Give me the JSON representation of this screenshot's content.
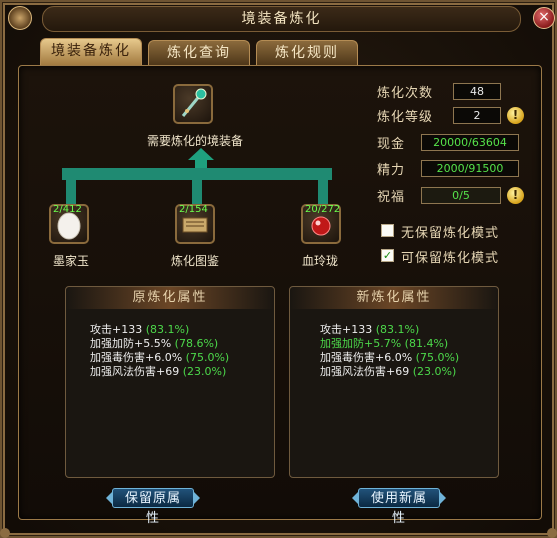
{
  "window": {
    "title": "境装备炼化",
    "close_label": "×"
  },
  "tabs": [
    {
      "label": "境装备炼化",
      "active": true
    },
    {
      "label": "炼化查询",
      "active": false
    },
    {
      "label": "炼化规则",
      "active": false
    }
  ],
  "target": {
    "label": "需要炼化的境装备",
    "icon": "staff-icon"
  },
  "materials": [
    {
      "count": "2/412",
      "name": "墨家玉",
      "icon": "jade-icon"
    },
    {
      "count": "2/154",
      "name": "炼化图鉴",
      "icon": "scroll-icon"
    },
    {
      "count": "20/272",
      "name": "血玲珑",
      "icon": "red-orb-icon"
    }
  ],
  "stats": {
    "refine_count_label": "炼化次数",
    "refine_count": "48",
    "refine_level_label": "炼化等级",
    "refine_level": "2",
    "cash_label": "现金",
    "cash": "20000/63604",
    "energy_label": "精力",
    "energy": "2000/91500",
    "blessing_label": "祝福",
    "blessing": "0/5",
    "warn_icon": "!"
  },
  "modes": {
    "no_keep_label": "无保留炼化模式",
    "no_keep_checked": false,
    "keep_label": "可保留炼化模式",
    "keep_checked": true,
    "check_mark": "✓"
  },
  "original": {
    "title": "原炼化属性",
    "attrs": [
      {
        "text": "攻击+133",
        "pct": "(83.1%)"
      },
      {
        "text": "加强加防+5.5%",
        "pct": "(78.6%)"
      },
      {
        "text": "加强毒伤害+6.0%",
        "pct": "(75.0%)"
      },
      {
        "text": "加强风法伤害+69",
        "pct": "(23.0%)"
      }
    ],
    "button": "保留原属性"
  },
  "new": {
    "title": "新炼化属性",
    "attrs": [
      {
        "text": "攻击+133",
        "pct": "(83.1%)"
      },
      {
        "text": "加强加防+5.7%",
        "pct": "(81.4%)"
      },
      {
        "text": "加强毒伤害+6.0%",
        "pct": "(75.0%)"
      },
      {
        "text": "加强风法伤害+69",
        "pct": "(23.0%)"
      }
    ],
    "button": "使用新属性"
  },
  "colors": {
    "accent": "#1f8a72",
    "highlight": "#55e24a",
    "gold": "#c9a468"
  }
}
